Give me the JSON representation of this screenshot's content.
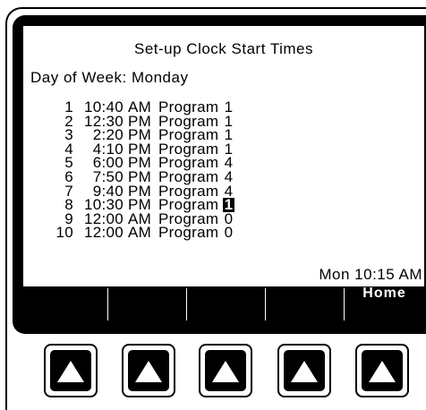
{
  "screen": {
    "title": "Set-up Clock Start Times",
    "day_of_week_label": "Day of Week:",
    "day_of_week_value": "Monday",
    "schedule": [
      {
        "num": "1",
        "time": "10:40",
        "ampm": "AM",
        "program_label": "Program",
        "program": "1",
        "selected": false
      },
      {
        "num": "2",
        "time": "12:30",
        "ampm": "PM",
        "program_label": "Program",
        "program": "1",
        "selected": false
      },
      {
        "num": "3",
        "time": "2:20",
        "ampm": "PM",
        "program_label": "Program",
        "program": "1",
        "selected": false
      },
      {
        "num": "4",
        "time": "4:10",
        "ampm": "PM",
        "program_label": "Program",
        "program": "1",
        "selected": false
      },
      {
        "num": "5",
        "time": "6:00",
        "ampm": "PM",
        "program_label": "Program",
        "program": "4",
        "selected": false
      },
      {
        "num": "6",
        "time": "7:50",
        "ampm": "PM",
        "program_label": "Program",
        "program": "4",
        "selected": false
      },
      {
        "num": "7",
        "time": "9:40",
        "ampm": "PM",
        "program_label": "Program",
        "program": "4",
        "selected": false
      },
      {
        "num": "8",
        "time": "10:30",
        "ampm": "PM",
        "program_label": "Program",
        "program": "1",
        "selected": true
      },
      {
        "num": "9",
        "time": "12:00",
        "ampm": "AM",
        "program_label": "Program",
        "program": "0",
        "selected": false
      },
      {
        "num": "10",
        "time": "12:00",
        "ampm": "AM",
        "program_label": "Program",
        "program": "0",
        "selected": false
      }
    ],
    "clock": "Mon 10:15 AM"
  },
  "softkeys": [
    "",
    "",
    "",
    "",
    "Home"
  ],
  "buttons": [
    {
      "icon": "up-arrow-icon"
    },
    {
      "icon": "up-arrow-icon"
    },
    {
      "icon": "up-arrow-icon"
    },
    {
      "icon": "up-arrow-icon"
    },
    {
      "icon": "up-arrow-icon"
    }
  ],
  "colors": {
    "screen_bg": "#ffffff",
    "frame": "#000000",
    "highlight": "#000000"
  }
}
